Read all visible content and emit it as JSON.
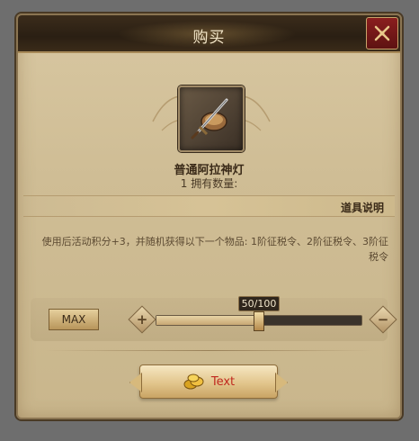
{
  "dialog": {
    "title": "购买",
    "close_icon": "close-x-icon"
  },
  "item": {
    "name": "普通阿拉神灯",
    "owned_text": "1 拥有数量:",
    "icon": "sword-and-shield-icon"
  },
  "description": {
    "header": "道具说明",
    "text": "使用后活动积分+3，并随机获得以下一个物品: 1阶征税令、2阶征税令、3阶征税令"
  },
  "quantity": {
    "max_label": "MAX",
    "label": "50/100",
    "current": 50,
    "maximum": 100,
    "plus_icon": "plus-icon",
    "minus_icon": "minus-icon"
  },
  "buy_button": {
    "label": "Text",
    "icon": "gold-coins-icon"
  },
  "colors": {
    "accent_red": "#c0281f",
    "panel": "#d8c7a1",
    "title_bar": "#2a1f13"
  }
}
